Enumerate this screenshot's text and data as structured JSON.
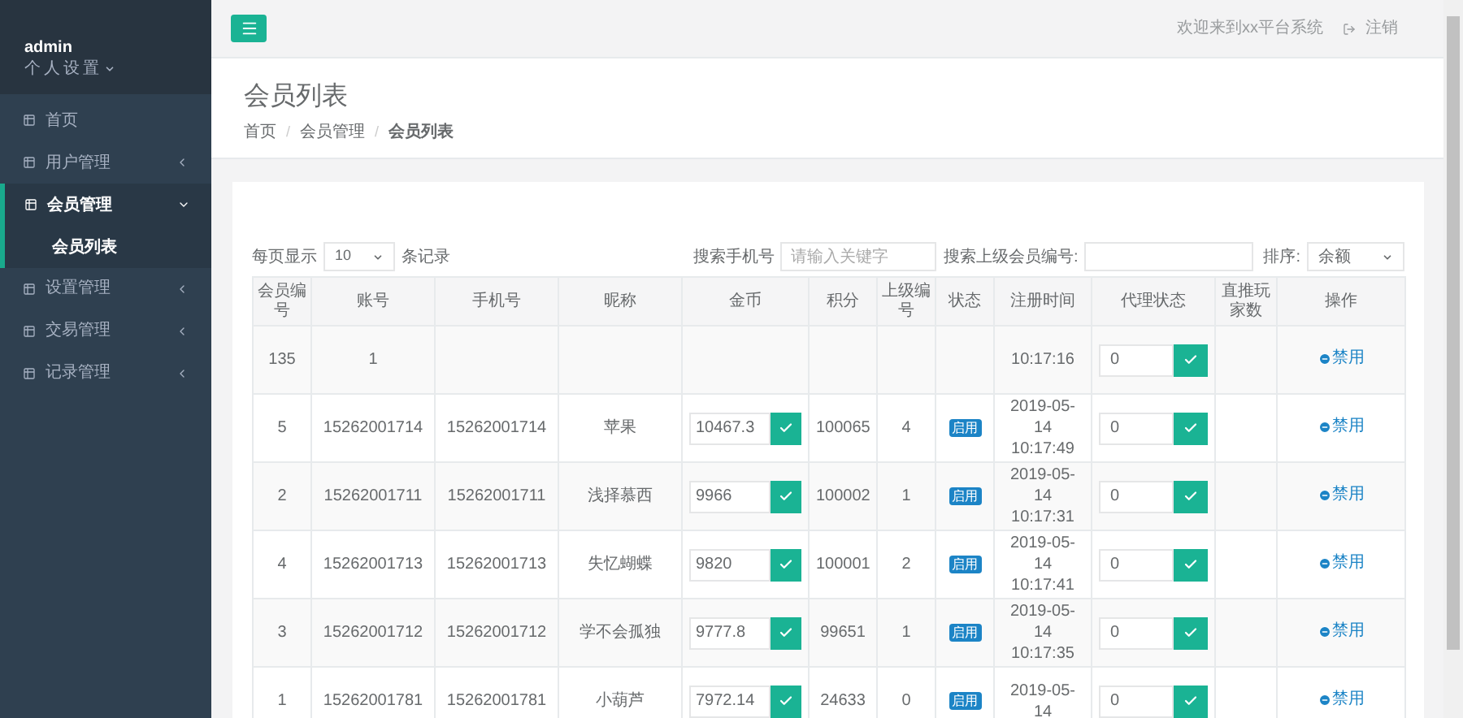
{
  "sidebar": {
    "user": {
      "name": "admin",
      "menu": "个人设置"
    },
    "items": [
      {
        "label": "首页",
        "expanded": false,
        "has_children": false
      },
      {
        "label": "用户管理",
        "expanded": false,
        "has_children": true
      },
      {
        "label": "会员管理",
        "expanded": true,
        "has_children": true,
        "children": [
          {
            "label": "会员列表",
            "selected": true
          }
        ]
      },
      {
        "label": "设置管理",
        "expanded": false,
        "has_children": true
      },
      {
        "label": "交易管理",
        "expanded": false,
        "has_children": true
      },
      {
        "label": "记录管理",
        "expanded": false,
        "has_children": true
      }
    ]
  },
  "topbar": {
    "welcome": "欢迎来到xx平台系统",
    "logout": "注销"
  },
  "page": {
    "title": "会员列表",
    "breadcrumb": [
      "首页",
      "会员管理",
      "会员列表"
    ],
    "breadcrumb_separator": "/"
  },
  "toolbar": {
    "per_page_label": "每页显示",
    "per_page": "10",
    "records_label": "条记录",
    "phone_search_label": "搜索手机号",
    "phone_search_placeholder": "请输入关键字",
    "parent_search_label": "搜索上级会员编号:",
    "sort_label": "排序:",
    "sort_value": "余额"
  },
  "table": {
    "columns": [
      "会员编号",
      "账号",
      "手机号",
      "昵称",
      "金币",
      "积分",
      "上级编号",
      "状态",
      "注册时间",
      "代理状态",
      "直推玩家数",
      "操作"
    ],
    "rows": [
      {
        "id": "135",
        "account": "1",
        "register_time": "10:17:16",
        "agent": "0",
        "action": "禁用"
      },
      {
        "id": "5",
        "account": "15262001714",
        "phone": "15262001714",
        "nickname": "苹果",
        "coins": "10467.3",
        "points": "100065",
        "parent": "4",
        "status": "启用",
        "register_time": "2019-05-14 10:17:49",
        "agent": "0",
        "action": "禁用"
      },
      {
        "id": "2",
        "account": "15262001711",
        "phone": "15262001711",
        "nickname": "浅择慕西",
        "coins": "9966",
        "points": "100002",
        "parent": "1",
        "status": "启用",
        "register_time": "2019-05-14 10:17:31",
        "agent": "0",
        "action": "禁用"
      },
      {
        "id": "4",
        "account": "15262001713",
        "phone": "15262001713",
        "nickname": "失忆蝴蝶",
        "coins": "9820",
        "points": "100001",
        "parent": "2",
        "status": "启用",
        "register_time": "2019-05-14 10:17:41",
        "agent": "0",
        "action": "禁用"
      },
      {
        "id": "3",
        "account": "15262001712",
        "phone": "15262001712",
        "nickname": "学不会孤独",
        "coins": "9777.8",
        "points": "99651",
        "parent": "1",
        "status": "启用",
        "register_time": "2019-05-14 10:17:35",
        "agent": "0",
        "action": "禁用"
      },
      {
        "id": "1",
        "account": "15262001781",
        "phone": "15262001781",
        "nickname": "小葫芦",
        "coins": "7972.14",
        "points": "24633",
        "parent": "0",
        "status": "启用",
        "register_time": "2019-05-14",
        "agent": "0",
        "action": "禁用"
      }
    ]
  }
}
